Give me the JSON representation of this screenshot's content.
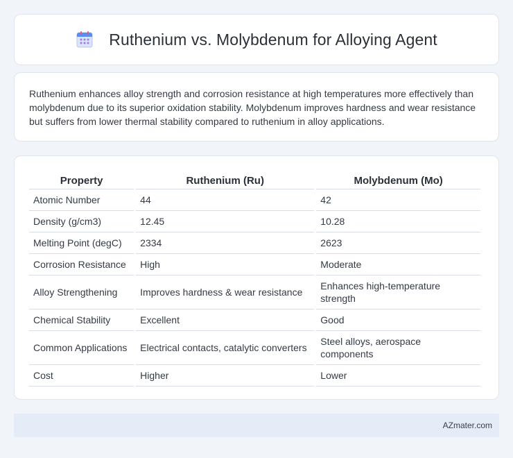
{
  "header": {
    "title": "Ruthenium vs. Molybdenum for Alloying Agent",
    "icon": "calendar-icon"
  },
  "summary": {
    "text": "Ruthenium enhances alloy strength and corrosion resistance at high temperatures more effectively than molybdenum due to its superior oxidation stability. Molybdenum improves hardness and wear resistance but suffers from lower thermal stability compared to ruthenium in alloy applications."
  },
  "table": {
    "headers": [
      "Property",
      "Ruthenium (Ru)",
      "Molybdenum (Mo)"
    ],
    "rows": [
      [
        "Atomic Number",
        "44",
        "42"
      ],
      [
        "Density (g/cm3)",
        "12.45",
        "10.28"
      ],
      [
        "Melting Point (degC)",
        "2334",
        "2623"
      ],
      [
        "Corrosion Resistance",
        "High",
        "Moderate"
      ],
      [
        "Alloy Strengthening",
        "Improves hardness & wear resistance",
        "Enhances high-temperature strength"
      ],
      [
        "Chemical Stability",
        "Excellent",
        "Good"
      ],
      [
        "Common Applications",
        "Electrical contacts, catalytic converters",
        "Steel alloys, aerospace components"
      ],
      [
        "Cost",
        "Higher",
        "Lower"
      ]
    ]
  },
  "footer": {
    "text": "AZmater.com"
  },
  "colors": {
    "background": "#f1f4f9",
    "card": "#ffffff",
    "footer_bg": "#e6ecf7"
  }
}
